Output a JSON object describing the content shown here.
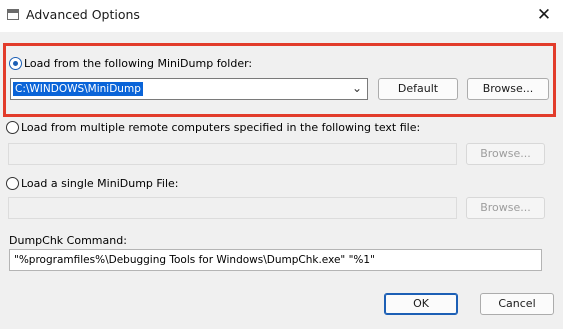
{
  "window": {
    "title": "Advanced Options",
    "close_glyph": "✕"
  },
  "section_minidump_folder": {
    "radio_label": "Load from the following MiniDump folder:",
    "selected": true,
    "folder_value": "C:\\WINDOWS\\MiniDump",
    "dropdown_glyph": "⌄",
    "default_button": "Default",
    "browse_button": "Browse..."
  },
  "section_remote": {
    "radio_label": "Load from multiple remote computers specified in the following text file:",
    "selected": false,
    "field_value": "",
    "browse_button": "Browse..."
  },
  "section_single_file": {
    "radio_label": "Load a single MiniDump File:",
    "selected": false,
    "field_value": "",
    "browse_button": "Browse..."
  },
  "dumpchk": {
    "label": "DumpChk Command:",
    "value": "\"%programfiles%\\Debugging Tools for Windows\\DumpChk.exe\" \"%1\""
  },
  "footer": {
    "ok_button": "OK",
    "cancel_button": "Cancel"
  },
  "colors": {
    "highlight_border": "#e23c2b",
    "accent": "#1c5fb5",
    "selection": "#0a64d8"
  }
}
